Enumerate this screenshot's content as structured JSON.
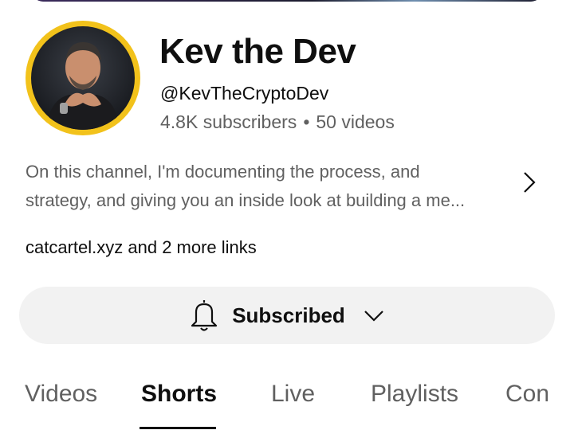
{
  "channel": {
    "name": "Kev the Dev",
    "handle": "@KevTheCryptoDev",
    "subscribers": "4.8K subscribers",
    "separator": "•",
    "videos": "50 videos",
    "description_line1": "On this channel, I'm documenting the process, and",
    "description_line2": "strategy, and giving you an inside look at building a me...",
    "links": "catcartel.xyz and 2 more links"
  },
  "subscribe_button": {
    "label": "Subscribed",
    "icon": "bell-icon"
  },
  "tabs": [
    {
      "label": "Videos"
    },
    {
      "label": "Shorts",
      "active": true
    },
    {
      "label": "Live"
    },
    {
      "label": "Playlists"
    },
    {
      "label": "Con"
    }
  ],
  "colors": {
    "avatar_ring": "#f2c21b",
    "secondary_text": "#606060",
    "button_bg": "#f2f2f2"
  }
}
